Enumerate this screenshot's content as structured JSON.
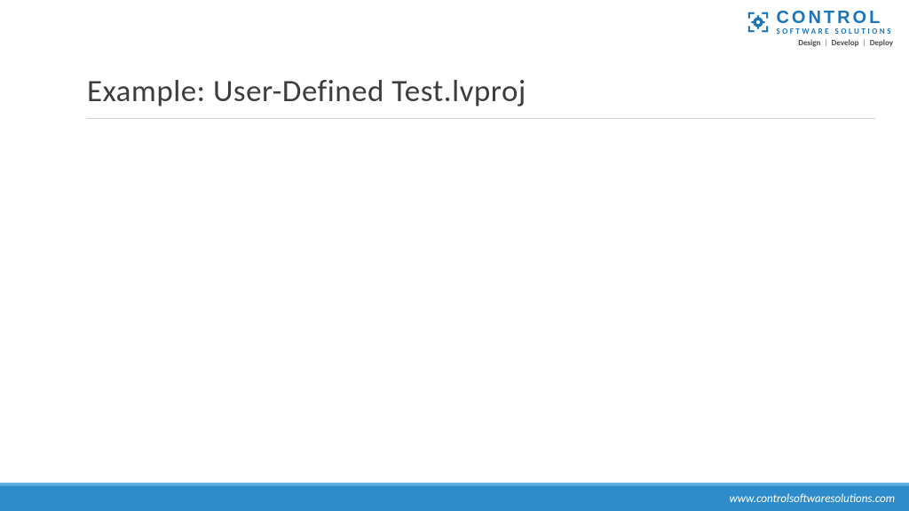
{
  "header": {
    "logo": {
      "brand_line1": "CONTROL",
      "brand_line2": "SOFTWARE SOLUTIONS",
      "tagline_1": "Design",
      "tagline_2": "Develop",
      "tagline_3": "Deploy"
    }
  },
  "slide": {
    "title": "Example: User-Defined Test.lvproj"
  },
  "footer": {
    "url": "www.controlsoftwaresolutions.com"
  },
  "colors": {
    "brand_blue": "#1b75bb",
    "footer_blue": "#2e8ccb"
  }
}
